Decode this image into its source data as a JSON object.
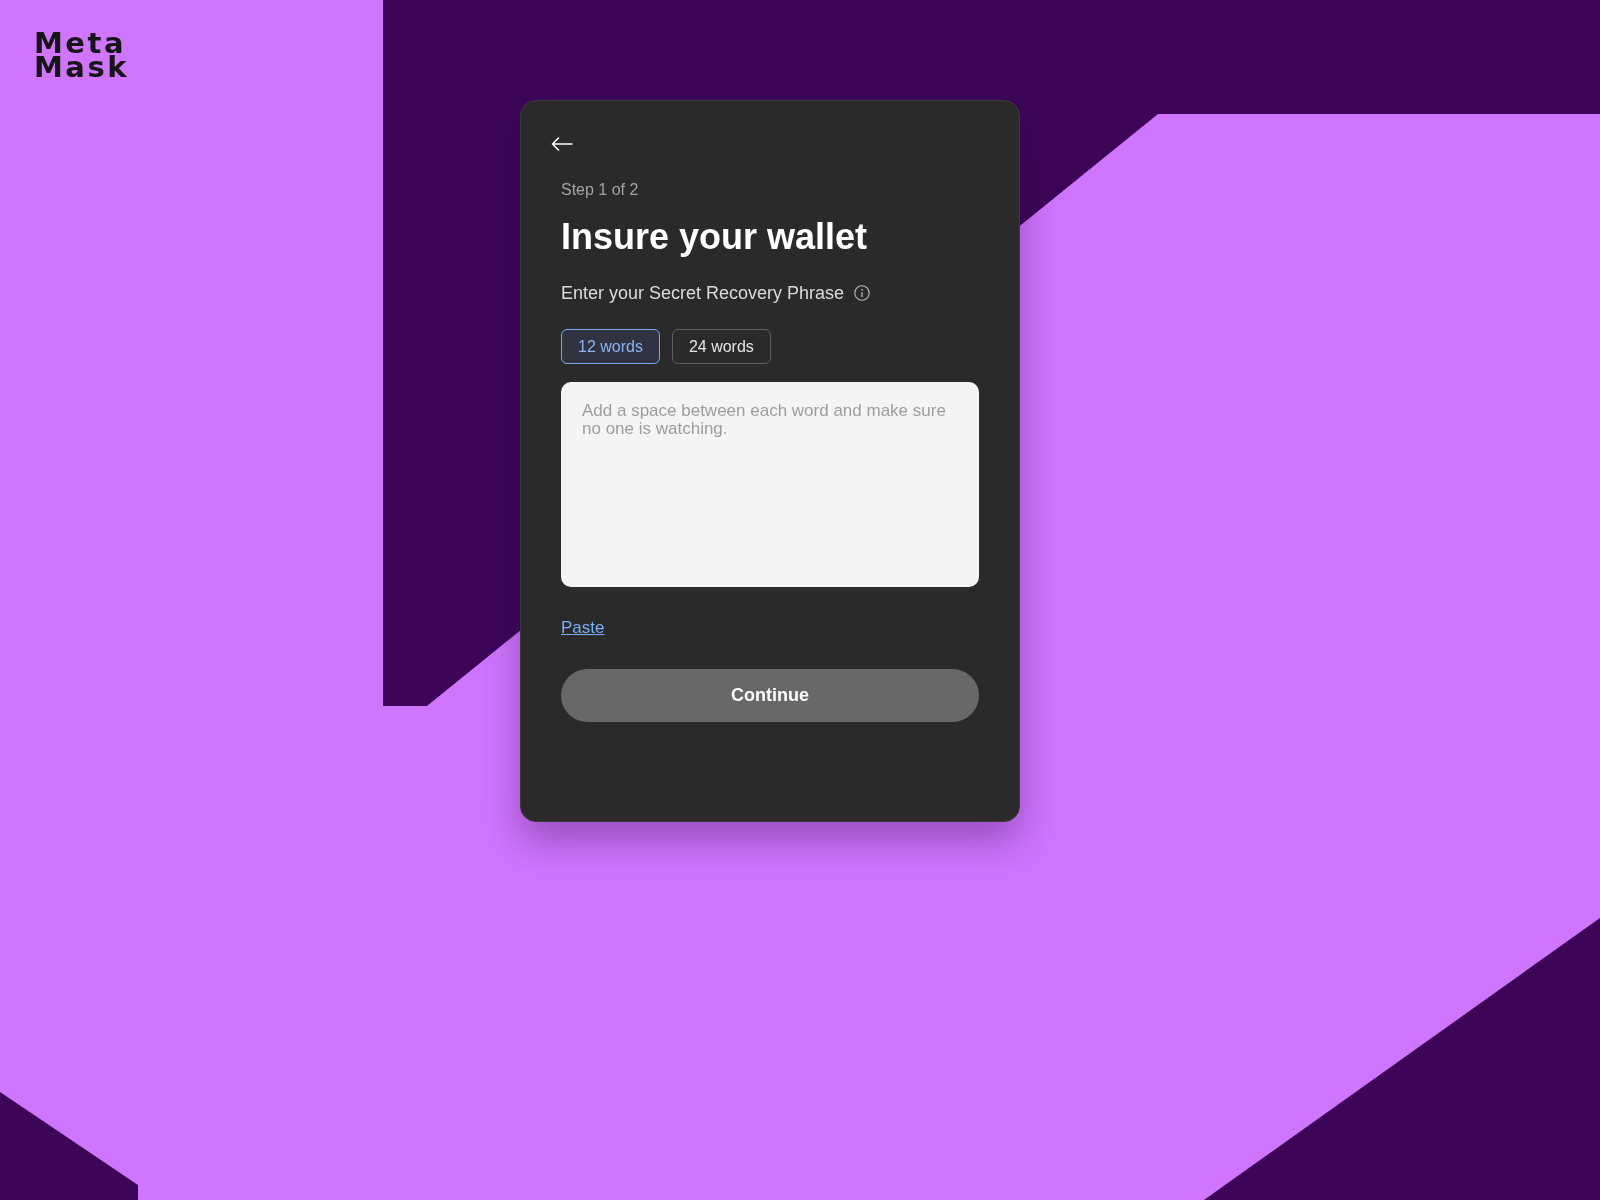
{
  "logo": {
    "lines": [
      "Meta",
      "Mask"
    ]
  },
  "card": {
    "step": "Step 1 of 2",
    "title": "Insure your wallet",
    "prompt": "Enter your Secret Recovery Phrase",
    "word_count_options": [
      {
        "label": "12 words",
        "selected": true
      },
      {
        "label": "24 words",
        "selected": false
      }
    ],
    "phrase_field": {
      "placeholder": "Add a space between each word and make sure no one is watching."
    },
    "paste_link": "Paste",
    "continue_button": {
      "label": "Continue",
      "disabled": true
    }
  }
}
